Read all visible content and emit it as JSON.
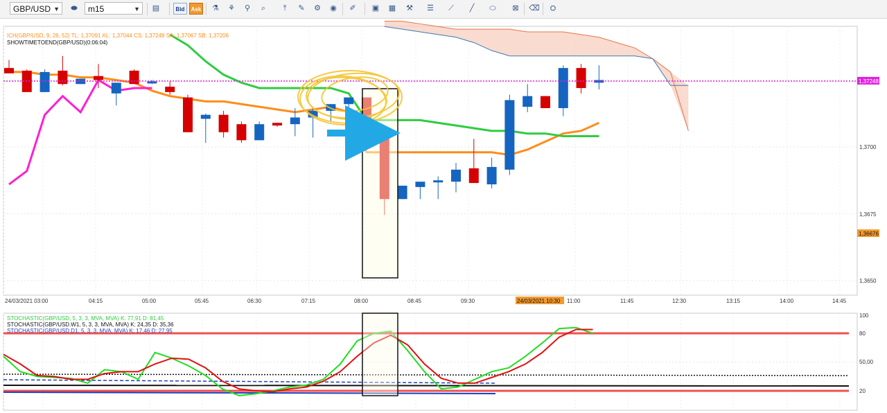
{
  "toolbar": {
    "symbol": "GBP/USD",
    "timeframe": "m15",
    "bid_label": "Bid",
    "ask_label": "Ask",
    "icons": [
      "bar-style-icon",
      "bar-chart-icon",
      "candle-icon",
      "zoom-in-icon",
      "zoom-out-icon",
      "zoom-fit-icon",
      "text-tool-icon",
      "templates-icon",
      "objects-icon",
      "globe-icon",
      "pencil-icon",
      "screenshot-icon",
      "print-icon",
      "settings-icon",
      "indicators-icon",
      "trend-line-icon",
      "channel-icon",
      "line-icon",
      "ellipse-icon",
      "close-icon",
      "eraser-icon",
      "cursor-icon"
    ]
  },
  "colors": {
    "bull": "#1565c0",
    "bear": "#d50000",
    "tenkan": "#ff8c1a",
    "kijun": "#2ecc40",
    "chikou": "#ff1fd0",
    "cloud_fill": "#f7cfc0",
    "cloud_edge_a": "#e8734a",
    "cloud_edge_b": "#3a7ab0",
    "price_line": "#e020e0",
    "stoch_level": "#f05050"
  },
  "legend": {
    "ich": "ICH(GBP/USD, 9, 26, 52)  TL: 1,37091  KL: 1,37044  CS: 1,37248  SA: 1,37067  SB: 1,37206",
    "timer": "SHOWTIMETOEND(GBP/USD)(0:06:04)",
    "stoch_m15": "STOCHASTIC(GBP/USD, 5, 3, 3, MVA, MVA)  K: 77,91  D: 81,45",
    "stoch_w1": "STOCHASTIC(GBP/USD.W1, 5, 3, 3, MVA, MVA)  K: 24,35  D: 35,36",
    "stoch_d1": "STOCHASTIC(GBP/USD.D1, 5, 3, 3, MVA, MVA)  K: 17,46  D: 27,95"
  },
  "price_axis": {
    "ticks": [
      "1,3700",
      "1,3675",
      "1,3650"
    ],
    "current_price": "1,37248",
    "marker_price": "1,36676"
  },
  "time_axis": {
    "ticks": [
      "24/03/2021 03:00",
      "04:15",
      "05:00",
      "05:45",
      "06:30",
      "07:15",
      "08:00",
      "08:45",
      "09:30",
      "11:00",
      "11:45",
      "12:30",
      "13:15",
      "14:00",
      "14:45"
    ],
    "cursor_label": "24/03/2021 10:30"
  },
  "stoch_axis": {
    "ticks": [
      "100",
      "80",
      "50,00",
      "20"
    ]
  },
  "chart_data": {
    "type": "candlestick",
    "symbol": "GBP/USD",
    "timeframe": "m15",
    "ylim": [
      1.3645,
      1.3745
    ],
    "candles": [
      {
        "o": 1.37295,
        "h": 1.37325,
        "l": 1.37275,
        "c": 1.37275
      },
      {
        "o": 1.37285,
        "h": 1.3729,
        "l": 1.37205,
        "c": 1.37205
      },
      {
        "o": 1.37205,
        "h": 1.3729,
        "l": 1.37205,
        "c": 1.3728
      },
      {
        "o": 1.37285,
        "h": 1.3734,
        "l": 1.3723,
        "c": 1.37235
      },
      {
        "o": 1.37235,
        "h": 1.37255,
        "l": 1.37235,
        "c": 1.37255
      },
      {
        "o": 1.37265,
        "h": 1.3731,
        "l": 1.3722,
        "c": 1.3725
      },
      {
        "o": 1.372,
        "h": 1.3724,
        "l": 1.37155,
        "c": 1.3724
      },
      {
        "o": 1.37285,
        "h": 1.3729,
        "l": 1.37235,
        "c": 1.37235
      },
      {
        "o": 1.37245,
        "h": 1.3725,
        "l": 1.37235,
        "c": 1.37245
      },
      {
        "o": 1.37225,
        "h": 1.37245,
        "l": 1.37195,
        "c": 1.37205
      },
      {
        "o": 1.37185,
        "h": 1.37195,
        "l": 1.37055,
        "c": 1.37055
      },
      {
        "o": 1.37105,
        "h": 1.37125,
        "l": 1.37015,
        "c": 1.3712
      },
      {
        "o": 1.3712,
        "h": 1.37135,
        "l": 1.37035,
        "c": 1.37055
      },
      {
        "o": 1.37085,
        "h": 1.37095,
        "l": 1.37015,
        "c": 1.37025
      },
      {
        "o": 1.37025,
        "h": 1.37095,
        "l": 1.37025,
        "c": 1.37085
      },
      {
        "o": 1.3709,
        "h": 1.3709,
        "l": 1.37075,
        "c": 1.3708
      },
      {
        "o": 1.37085,
        "h": 1.37145,
        "l": 1.3704,
        "c": 1.3711
      },
      {
        "o": 1.3711,
        "h": 1.3715,
        "l": 1.37035,
        "c": 1.37135
      },
      {
        "o": 1.37135,
        "h": 1.3716,
        "l": 1.37095,
        "c": 1.3716
      },
      {
        "o": 1.3716,
        "h": 1.37175,
        "l": 1.37135,
        "c": 1.37185
      },
      {
        "o": 1.37185,
        "h": 1.37185,
        "l": 1.37055,
        "c": 1.37055
      },
      {
        "o": 1.37055,
        "h": 1.37055,
        "l": 1.36745,
        "c": 1.36805
      },
      {
        "o": 1.36805,
        "h": 1.36855,
        "l": 1.36805,
        "c": 1.36855
      },
      {
        "o": 1.3685,
        "h": 1.3686,
        "l": 1.36805,
        "c": 1.3687
      },
      {
        "o": 1.36875,
        "h": 1.3689,
        "l": 1.36805,
        "c": 1.36875
      },
      {
        "o": 1.3687,
        "h": 1.3694,
        "l": 1.3683,
        "c": 1.36915
      },
      {
        "o": 1.3692,
        "h": 1.3703,
        "l": 1.36865,
        "c": 1.36865
      },
      {
        "o": 1.3686,
        "h": 1.3696,
        "l": 1.36845,
        "c": 1.36925
      },
      {
        "o": 1.36915,
        "h": 1.37195,
        "l": 1.36895,
        "c": 1.37175
      },
      {
        "o": 1.3715,
        "h": 1.37235,
        "l": 1.3713,
        "c": 1.3719
      },
      {
        "o": 1.3719,
        "h": 1.3719,
        "l": 1.37165,
        "c": 1.37145
      },
      {
        "o": 1.37145,
        "h": 1.37305,
        "l": 1.37115,
        "c": 1.37295
      },
      {
        "o": 1.37295,
        "h": 1.3731,
        "l": 1.372,
        "c": 1.3722
      },
      {
        "o": 1.3724,
        "h": 1.37305,
        "l": 1.37215,
        "c": 1.3725
      }
    ],
    "tenkan": [
      1.3728,
      1.3728,
      1.3727,
      1.3727,
      1.3726,
      1.3726,
      1.3725,
      1.3724,
      1.3721,
      1.3719,
      1.3718,
      1.3717,
      1.3717,
      1.3716,
      1.3715,
      1.3714,
      1.3713,
      1.3714,
      1.3715,
      1.3713,
      1.3698,
      1.3698,
      1.3698,
      1.3698,
      1.3698,
      1.3698,
      1.3698,
      1.3698,
      1.3697,
      1.3699,
      1.3702,
      1.3705,
      1.3706,
      1.3709
    ],
    "kijun_start_index": 9,
    "kijun": [
      1.3742,
      1.3738,
      1.3732,
      1.3727,
      1.3724,
      1.3722,
      1.3722,
      1.3722,
      1.3722,
      1.3722,
      1.372,
      1.371,
      1.371,
      1.371,
      1.371,
      1.3709,
      1.3708,
      1.3707,
      1.3706,
      1.3706,
      1.3705,
      1.3705,
      1.3704,
      1.3704,
      1.3704
    ],
    "chikou": [
      1.3686,
      1.3691,
      1.3712,
      1.3719,
      1.3713,
      1.3725,
      1.3721,
      1.3722,
      1.3722
    ],
    "span_a": [
      1.3747,
      1.3747,
      1.3746,
      1.3745,
      1.3744,
      1.3744,
      1.3744,
      1.3744,
      1.3743,
      1.3743,
      1.3743,
      1.3742,
      1.3741,
      1.3739,
      1.3737,
      1.3733,
      1.3728,
      1.3706
    ],
    "span_b": [
      1.3745,
      1.3744,
      1.3743,
      1.3742,
      1.3741,
      1.3739,
      1.3736,
      1.3734,
      1.3734,
      1.3734,
      1.3734,
      1.3734,
      1.3734,
      1.3734,
      1.3734,
      1.3733,
      1.3723,
      1.3723
    ],
    "cloud_start_index": 21,
    "current_price": 1.37248,
    "stochastic": {
      "ylim": [
        0,
        100
      ],
      "levels": [
        80,
        20
      ],
      "m15_k": [
        56,
        40,
        35,
        34,
        33,
        28,
        42,
        40,
        32,
        60,
        54,
        46,
        36,
        22,
        15,
        17,
        20,
        24,
        26,
        32,
        48,
        72,
        80,
        82,
        62,
        40,
        22,
        24,
        32,
        40,
        44,
        56,
        70,
        85,
        86,
        80
      ],
      "m15_d": [
        58,
        48,
        36,
        35,
        32,
        32,
        38,
        40,
        40,
        48,
        54,
        53,
        44,
        30,
        22,
        20,
        19,
        22,
        24,
        30,
        40,
        56,
        70,
        78,
        68,
        48,
        33,
        28,
        28,
        34,
        40,
        48,
        60,
        76,
        84,
        84
      ],
      "w1_k": 24.35,
      "w1_d": 35.36,
      "d1_k": 17.46,
      "d1_d": 27.95
    }
  }
}
